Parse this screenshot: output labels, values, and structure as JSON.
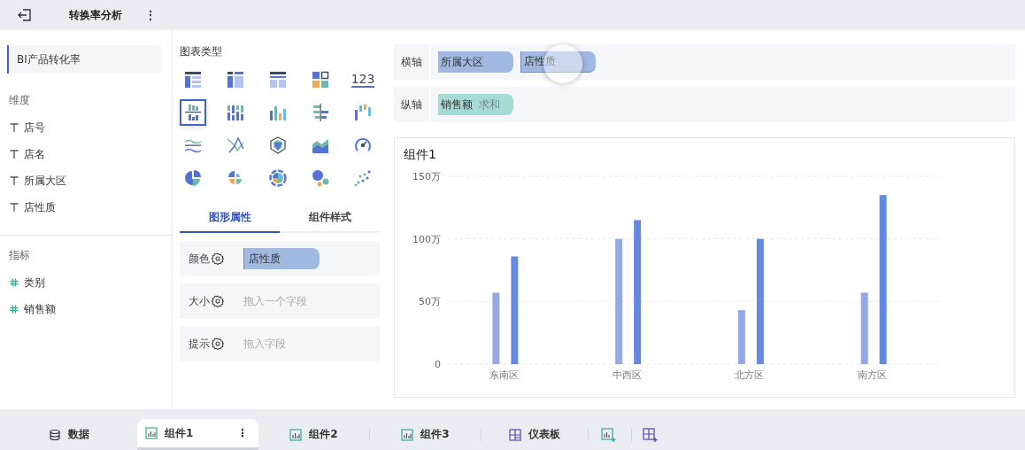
{
  "top_bar": {
    "title": "转换率分析",
    "menu": "⋮"
  },
  "datasets": [
    {
      "label": "BI产品转化率",
      "selected": true
    }
  ],
  "dimensions": {
    "title": "维度",
    "fields": [
      {
        "kind": "text",
        "label": "店号"
      },
      {
        "kind": "text",
        "label": "店名"
      },
      {
        "kind": "text",
        "label": "所属大区"
      },
      {
        "kind": "text",
        "label": "店性质"
      }
    ]
  },
  "measures": {
    "title": "指标",
    "fields": [
      {
        "kind": "number",
        "label": "类别"
      },
      {
        "kind": "number",
        "label": "销售额"
      }
    ]
  },
  "chart_types": {
    "title": "图表类型",
    "items": [
      {
        "kind": "detail-table",
        "selected": false
      },
      {
        "kind": "group-table",
        "selected": false
      },
      {
        "kind": "cross-table",
        "selected": false
      },
      {
        "kind": "tiles",
        "selected": false
      },
      {
        "kind": "number",
        "label": "123",
        "selected": false
      },
      {
        "kind": "grouped-bar",
        "selected": true
      },
      {
        "kind": "stacked-bar",
        "selected": false
      },
      {
        "kind": "bar",
        "selected": false
      },
      {
        "kind": "diverging-bar",
        "selected": false
      },
      {
        "kind": "range-bar",
        "selected": false
      },
      {
        "kind": "wave-line",
        "selected": false
      },
      {
        "kind": "cross-line",
        "selected": false
      },
      {
        "kind": "radar",
        "selected": false
      },
      {
        "kind": "area",
        "selected": false
      },
      {
        "kind": "gauge",
        "selected": false
      },
      {
        "kind": "pie",
        "selected": false
      },
      {
        "kind": "rose",
        "selected": false
      },
      {
        "kind": "sunburst",
        "selected": false
      },
      {
        "kind": "bubble",
        "selected": false
      },
      {
        "kind": "scatter",
        "selected": false
      }
    ]
  },
  "property_tabs": [
    {
      "label": "图形属性",
      "selected": true
    },
    {
      "label": "组件样式",
      "selected": false
    }
  ],
  "properties": [
    {
      "label": "颜色",
      "pill": "店性质"
    },
    {
      "label": "大小",
      "placeholder": "拖入一个字段"
    },
    {
      "label": "提示",
      "placeholder": "拖入字段"
    }
  ],
  "axes": [
    {
      "label": "横轴",
      "pills": [
        {
          "kind": "dimension",
          "label": "所属大区",
          "active": false
        },
        {
          "kind": "dimension",
          "label": "店性质",
          "active": true
        }
      ]
    },
    {
      "label": "纵轴",
      "pills": [
        {
          "kind": "measure",
          "label": "销售额",
          "aggregate": "求和",
          "active": false
        }
      ]
    }
  ],
  "chart": {
    "title": "组件1",
    "chart_data": {
      "type": "bar",
      "categories": [
        "东南区",
        "中西区",
        "北方区",
        "南方区"
      ],
      "series": [
        {
          "color": "#94a8e6",
          "values": [
            57,
            100,
            43,
            57
          ]
        },
        {
          "color": "#6389e3",
          "values": [
            86,
            115,
            100,
            135
          ]
        }
      ],
      "ylim": [
        0,
        150
      ],
      "yticks": [
        {
          "value": 0,
          "label": "0"
        },
        {
          "value": 50,
          "label": "50万"
        },
        {
          "value": 100,
          "label": "100万"
        },
        {
          "value": 150,
          "label": "150万"
        }
      ]
    }
  },
  "bottom_tabs": [
    {
      "kind": "data",
      "label": "数据",
      "selected": false
    },
    {
      "kind": "component",
      "label": "组件1",
      "selected": true,
      "menu": "⋮"
    },
    {
      "kind": "component",
      "label": "组件2",
      "selected": false
    },
    {
      "kind": "component",
      "label": "组件3",
      "selected": false
    },
    {
      "kind": "dashboard",
      "label": "仪表板",
      "selected": false
    }
  ],
  "bottom_actions": [
    {
      "kind": "add-component"
    },
    {
      "kind": "add-dashboard"
    }
  ]
}
